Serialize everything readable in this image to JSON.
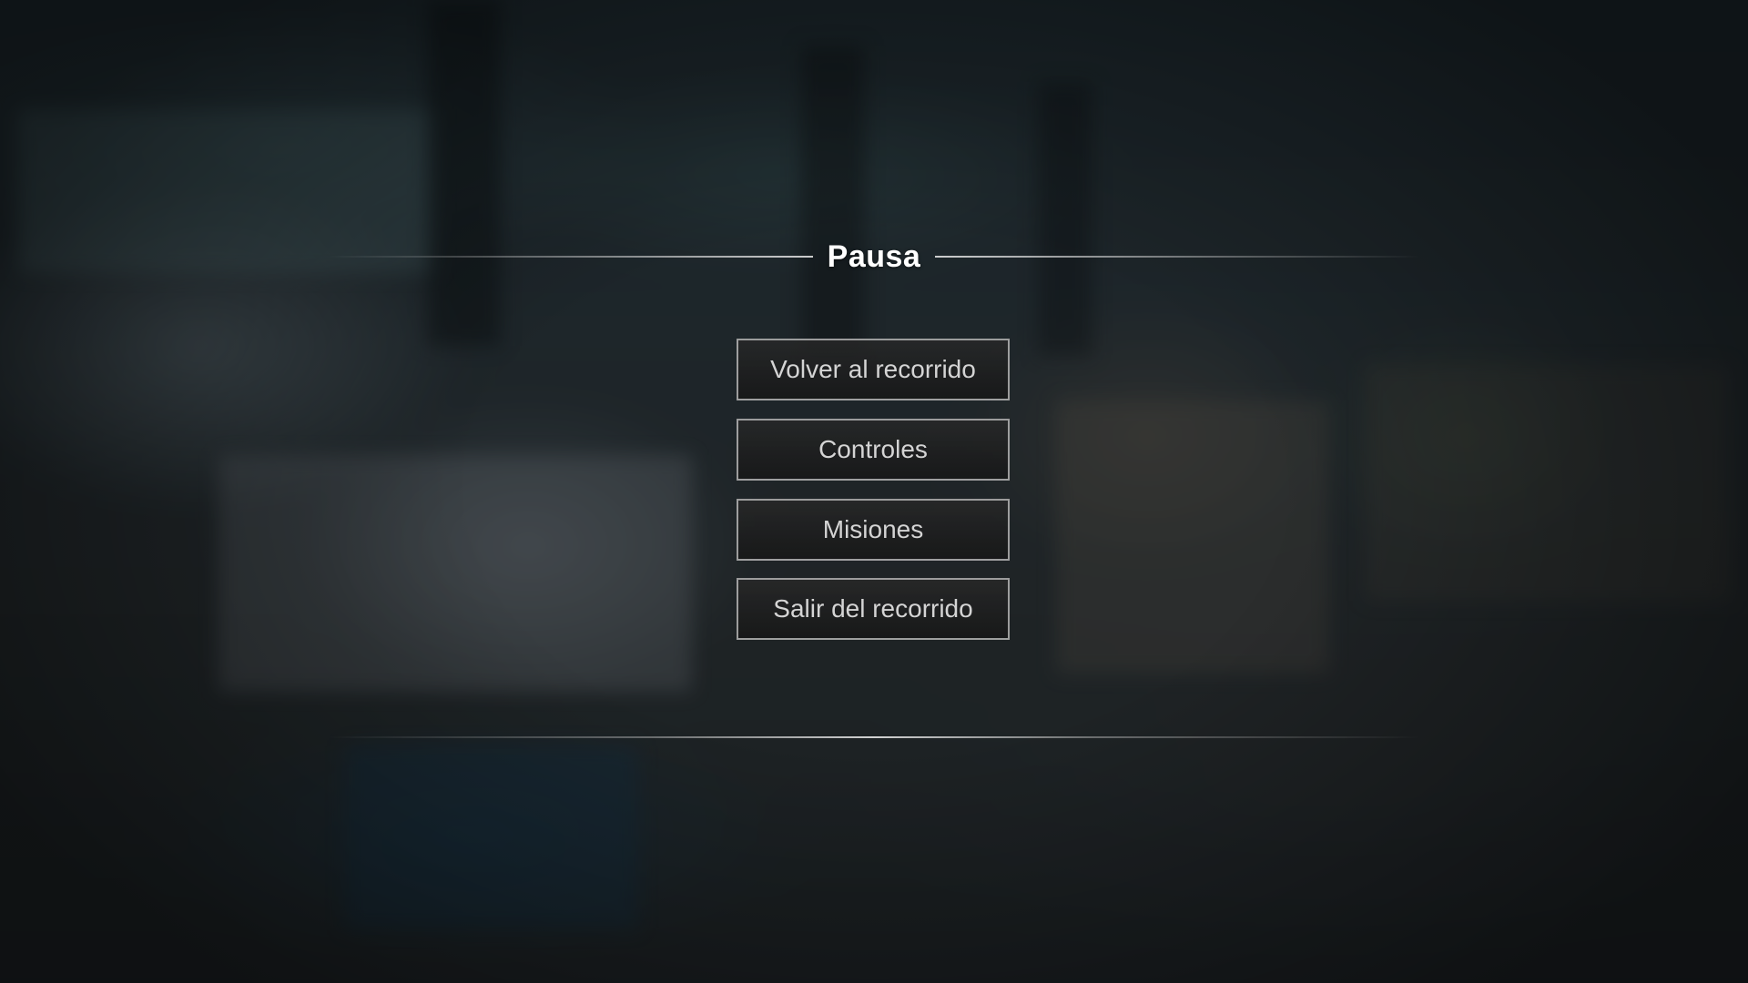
{
  "pause_menu": {
    "title": "Pausa",
    "buttons": [
      {
        "id": "resume",
        "label": "Volver al recorrido"
      },
      {
        "id": "controls",
        "label": "Controles"
      },
      {
        "id": "missions",
        "label": "Misiones"
      },
      {
        "id": "exit",
        "label": "Salir del recorrido"
      }
    ]
  },
  "colors": {
    "title": "#ffffff",
    "button_text": "#d4d4d4",
    "button_border": "#c8c8c8",
    "overlay": "#0a0e12"
  }
}
